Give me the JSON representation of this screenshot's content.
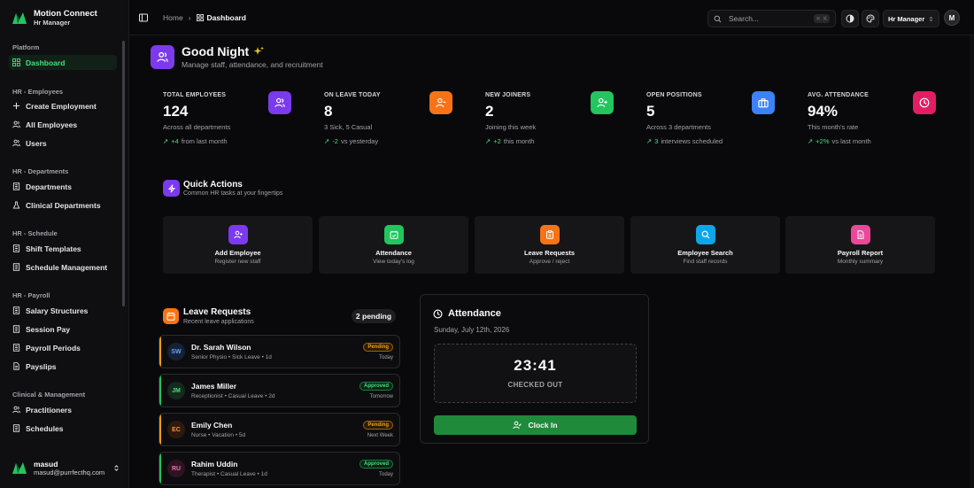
{
  "brand": {
    "name": "Motion Connect",
    "role": "Hr Manager",
    "logo_color": "#22c55e"
  },
  "sidebar": {
    "groups": [
      {
        "label": "Platform",
        "items": [
          {
            "label": "Dashboard",
            "icon": "grid-icon",
            "active": true
          }
        ]
      },
      {
        "label": "HR - Employees",
        "items": [
          {
            "label": "Create Employment",
            "icon": "plus-icon"
          },
          {
            "label": "All Employees",
            "icon": "users-icon"
          },
          {
            "label": "Users",
            "icon": "users-icon"
          }
        ]
      },
      {
        "label": "HR - Departments",
        "items": [
          {
            "label": "Departments",
            "icon": "building-icon"
          },
          {
            "label": "Clinical Departments",
            "icon": "flask-icon"
          }
        ]
      },
      {
        "label": "HR - Schedule",
        "items": [
          {
            "label": "Shift Templates",
            "icon": "building-icon"
          },
          {
            "label": "Schedule Management",
            "icon": "building-icon"
          }
        ]
      },
      {
        "label": "HR - Payroll",
        "items": [
          {
            "label": "Salary Structures",
            "icon": "building-icon"
          },
          {
            "label": "Session Pay",
            "icon": "building-icon"
          },
          {
            "label": "Payroll Periods",
            "icon": "building-icon"
          },
          {
            "label": "Payslips",
            "icon": "file-icon"
          }
        ]
      },
      {
        "label": "Clinical & Management",
        "items": [
          {
            "label": "Practitioners",
            "icon": "users-icon"
          },
          {
            "label": "Schedules",
            "icon": "building-icon"
          }
        ]
      }
    ],
    "user": {
      "name": "masud",
      "email": "masud@purrfecthq.com"
    }
  },
  "topbar": {
    "breadcrumb": {
      "home": "Home",
      "current": "Dashboard"
    },
    "search": {
      "placeholder": "Search...",
      "shortcut": "⌘ K"
    },
    "role": "Hr Manager",
    "avatar": "M"
  },
  "greeting": {
    "title": "Good Night",
    "subtitle": "Manage staff, attendance, and recruitment"
  },
  "stats": [
    {
      "label": "Total Employees",
      "value": "124",
      "sub": "Across all departments",
      "trend": "+4",
      "trend_text": "from last month",
      "color": "#7c3aed",
      "icon": "users-icon"
    },
    {
      "label": "On Leave Today",
      "value": "8",
      "sub": "3 Sick, 5 Casual",
      "trend": "-2",
      "trend_text": "vs yesterday",
      "color": "#f97316",
      "icon": "user-minus-icon"
    },
    {
      "label": "New Joiners",
      "value": "2",
      "sub": "Joining this week",
      "trend": "+2",
      "trend_text": "this month",
      "color": "#22c55e",
      "icon": "user-plus-icon"
    },
    {
      "label": "Open Positions",
      "value": "5",
      "sub": "Across 3 departments",
      "trend": "3",
      "trend_text": "interviews scheduled",
      "color": "#3b82f6",
      "icon": "briefcase-icon"
    },
    {
      "label": "Avg. Attendance",
      "value": "94%",
      "sub": "This month's rate",
      "trend": "+2%",
      "trend_text": "vs last month",
      "color": "#e11d63",
      "icon": "clock-icon"
    }
  ],
  "quick_actions": {
    "title": "Quick Actions",
    "subtitle": "Common HR tasks at your fingertips",
    "cards": [
      {
        "label": "Add Employee",
        "sub": "Register new staff",
        "color": "#7c3aed",
        "icon": "user-plus-icon"
      },
      {
        "label": "Attendance",
        "sub": "View today's log",
        "color": "#22c55e",
        "icon": "calendar-check-icon"
      },
      {
        "label": "Leave Requests",
        "sub": "Approve / reject",
        "color": "#f97316",
        "icon": "clipboard-icon"
      },
      {
        "label": "Employee Search",
        "sub": "Find staff records",
        "color": "#0ea5e9",
        "icon": "search-icon"
      },
      {
        "label": "Payroll Report",
        "sub": "Monthly summary",
        "color": "#ec4899",
        "icon": "file-icon"
      }
    ]
  },
  "leave_requests": {
    "title": "Leave Requests",
    "subtitle": "Recent leave applications",
    "badge": "2 pending",
    "items": [
      {
        "initials": "SW",
        "name": "Dr. Sarah Wilson",
        "detail": "Senior Physio • Sick Leave • 1d",
        "status": "Pending",
        "when": "Today"
      },
      {
        "initials": "JM",
        "name": "James Miller",
        "detail": "Receptionist • Casual Leave • 2d",
        "status": "Approved",
        "when": "Tomorrow"
      },
      {
        "initials": "EC",
        "name": "Emily Chen",
        "detail": "Nurse • Vacation • 5d",
        "status": "Pending",
        "when": "Next Week"
      },
      {
        "initials": "RU",
        "name": "Rahim Uddin",
        "detail": "Therapist • Casual Leave • 1d",
        "status": "Approved",
        "when": "Today"
      }
    ]
  },
  "attendance": {
    "title": "Attendance",
    "date": "Sunday, July 12th, 2026",
    "time": "23:41",
    "status": "CHECKED OUT",
    "button": "Clock In"
  }
}
